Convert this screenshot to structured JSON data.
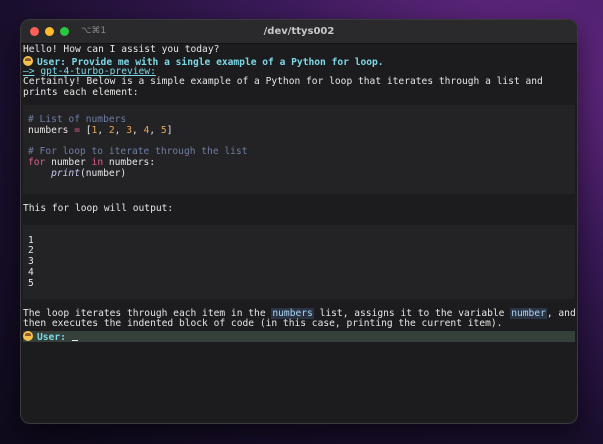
{
  "window": {
    "title": "/dev/ttys002",
    "shortcut": "⌥⌘1"
  },
  "terminal": {
    "greeting": "Hello! How can I assist you today?",
    "user_label": "User:",
    "user_message": "Provide me with a single example of a Python for loop.",
    "model_arrow": "—>",
    "model_name": "gpt-4-turbo-preview:",
    "response_line1": "Certainly! Below is a simple example of a Python for loop that iterates through a list and",
    "response_line2": "prints each element:",
    "code": {
      "comment1": "# List of numbers",
      "var": "numbers",
      "assign": " = ",
      "list_open": "[",
      "list_close": "]",
      "n1": "1",
      "n2": "2",
      "n3": "3",
      "n4": "4",
      "n5": "5",
      "comment2": "# For loop to iterate through the list",
      "kw_for": "for",
      "loop_var": " number ",
      "kw_in": "in",
      "loop_rest": " numbers:",
      "indent": "    ",
      "fn_print": "print",
      "print_args": "(number)"
    },
    "output_intro": "This for loop will output:",
    "output_values": [
      "1",
      "2",
      "3",
      "4",
      "5"
    ],
    "explain_part1": "The loop iterates through each item in the ",
    "explain_code1": "numbers",
    "explain_part2": " list, assigns it to the variable ",
    "explain_code2": "number",
    "explain_part3": ", and",
    "explain_line2": "then executes the indented block of code (in this case, printing the current item).",
    "prompt_label": "User:"
  }
}
